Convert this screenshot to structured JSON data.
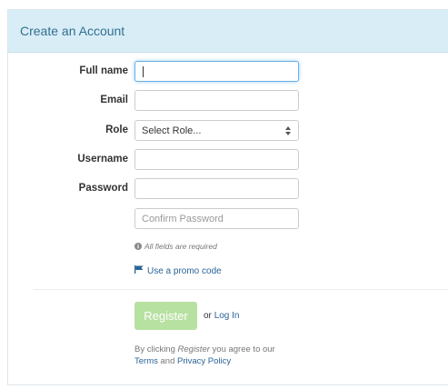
{
  "panel": {
    "title": "Create an Account"
  },
  "form": {
    "full_name": {
      "label": "Full name",
      "value": ""
    },
    "email": {
      "label": "Email",
      "value": ""
    },
    "role": {
      "label": "Role",
      "selected": "Select Role..."
    },
    "username": {
      "label": "Username",
      "value": ""
    },
    "password": {
      "label": "Password",
      "value": ""
    },
    "confirm_password": {
      "placeholder": "Confirm Password",
      "value": ""
    },
    "help_text": "All fields are required",
    "promo_link": "Use a promo code"
  },
  "actions": {
    "register_label": "Register",
    "or_text": "or",
    "login_link": "Log In",
    "terms_prefix": "By clicking",
    "terms_register": "Register",
    "terms_middle": "you agree to our",
    "terms_link": "Terms",
    "terms_and": "and",
    "privacy_link": "Privacy Policy"
  },
  "colors": {
    "heading_bg": "#d9edf7",
    "heading_text": "#31708f",
    "link": "#2a6496",
    "register_bg": "#b7e1a1",
    "focus_border": "#66afe9"
  },
  "icons": {
    "help": "info-circle-icon",
    "promo": "flag-icon",
    "select": "sort-arrows-icon"
  }
}
